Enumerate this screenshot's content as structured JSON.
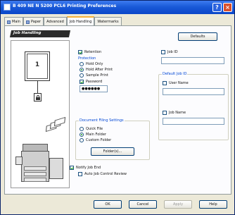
{
  "window": {
    "title": "B 409 NE N 5200 PCL6 Printing Preferences",
    "help_glyph": "?",
    "close_glyph": "×"
  },
  "tabs": [
    {
      "label": "Main"
    },
    {
      "label": "Paper"
    },
    {
      "label": "Advanced"
    },
    {
      "label": "Job Handling"
    },
    {
      "label": "Watermarks"
    }
  ],
  "panel": {
    "banner": "Job Handling",
    "defaults_button": "Defaults",
    "preview_page_number": "1"
  },
  "options": {
    "retention_label": "Retention",
    "retention_checked": true,
    "protection_label": "Protection",
    "radios": [
      {
        "label": "Hold Only",
        "checked": false
      },
      {
        "label": "Hold After Print",
        "checked": true
      },
      {
        "label": "Sample Print",
        "checked": false
      }
    ],
    "password_label": "Password",
    "password_checked": true,
    "password_value": "●●●●●●"
  },
  "job_id": {
    "label": "Job ID",
    "value": ""
  },
  "default_job_id": {
    "group_label": "Default Job ID",
    "user_name_label": "User Name",
    "user_name_value": "",
    "job_name_label": "Job Name",
    "job_name_value": ""
  },
  "document_filing": {
    "group_label": "Document Filing Settings",
    "radios": [
      {
        "label": "Quick File",
        "checked": false
      },
      {
        "label": "Main Folder",
        "checked": true
      },
      {
        "label": "Custom Folder",
        "checked": false
      }
    ],
    "folder_button": "Folder(s)..."
  },
  "notify": {
    "label": "Notify Job End",
    "checked": true,
    "auto_label": "Auto Job Control Review",
    "auto_checked": false
  },
  "footer": {
    "ok": "OK",
    "cancel": "Cancel",
    "apply": "Apply",
    "help": "Help"
  }
}
